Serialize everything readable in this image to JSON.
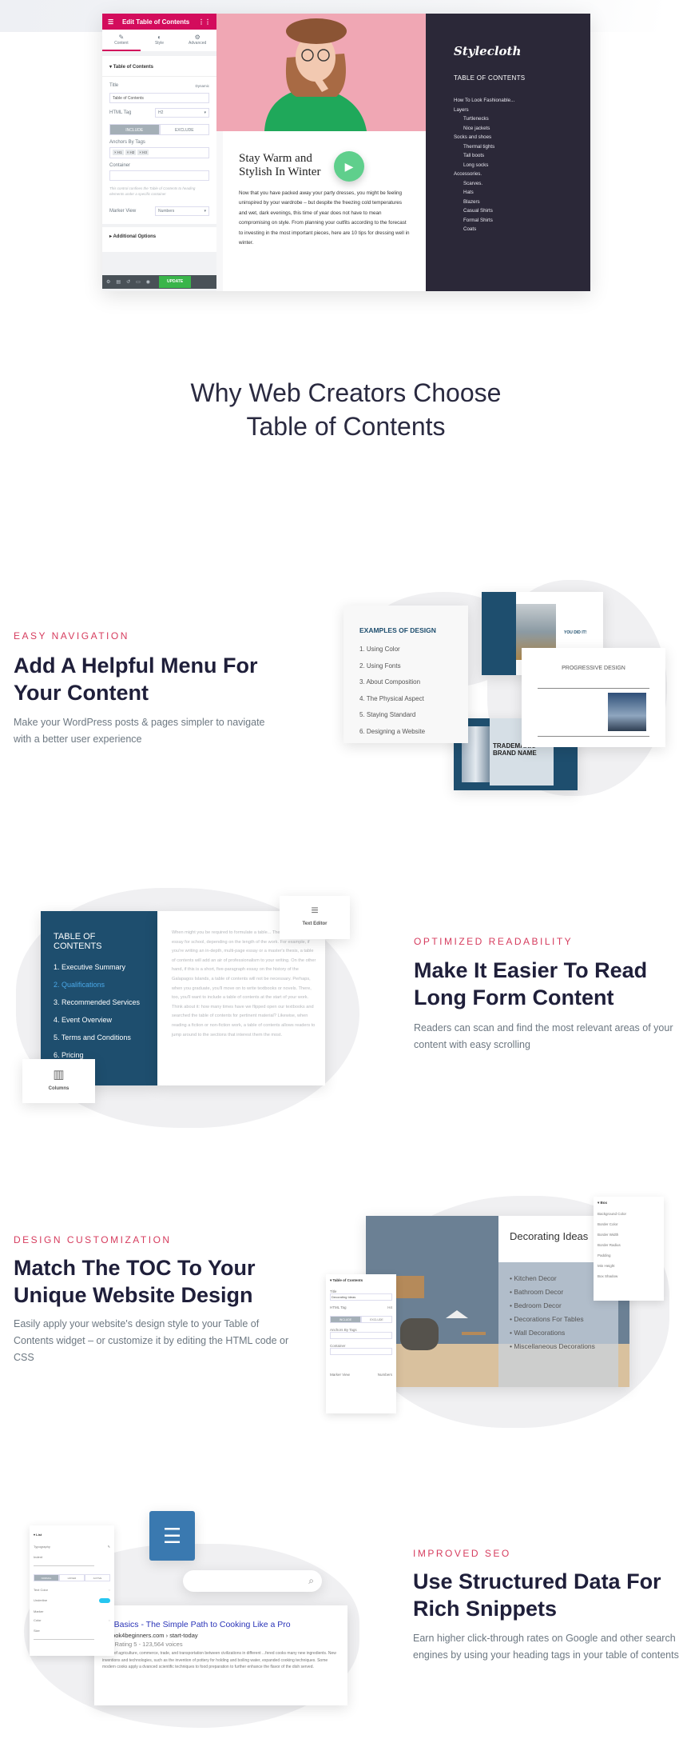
{
  "editor": {
    "header_title": "Edit Table of Contents",
    "tabs": [
      {
        "label": "Content",
        "icon": "pencil-icon"
      },
      {
        "label": "Style",
        "icon": "half-circle-icon"
      },
      {
        "label": "Advanced",
        "icon": "gear-icon"
      }
    ],
    "section": "Table of Contents",
    "title_label": "Title",
    "dynamic_label": "Dynamic",
    "title_value": "Table of Contents",
    "html_tag_label": "HTML Tag",
    "html_tag_value": "H2",
    "include": "INCLUDE",
    "exclude": "EXCLUDE",
    "anchors_label": "Anchors By Tags",
    "tags": [
      "× H1",
      "× H2",
      "× H3"
    ],
    "container_label": "Container",
    "help": "This control confines the Table of Contents to heading elements under a specific container",
    "marker_label": "Marker View",
    "marker_value": "Numbers",
    "additional": "Additional Options",
    "update": "UPDATE"
  },
  "article": {
    "heading": "Stay Warm and Stylish In Winter",
    "body": "Now that you have packed away your party dresses, you might be feeling uninspired by your wardrobe – but despite the freezing cold temperatures and wet, dark evenings, this time of year does not have to mean compromising on style. From planning your outfits according to the forecast to investing in the most important pieces, here are 10 tips for dressing well in winter."
  },
  "stylecloth": {
    "logo": "Stylecloth",
    "toc_title": "TABLE OF CONTENTS",
    "items": [
      {
        "label": "How To Look Fashionable...",
        "sub": false
      },
      {
        "label": "Layers",
        "sub": false
      },
      {
        "label": "Turtlenecks",
        "sub": true
      },
      {
        "label": "Nice jackets",
        "sub": true
      },
      {
        "label": "Socks and shoes",
        "sub": false
      },
      {
        "label": "Thermal tights",
        "sub": true
      },
      {
        "label": "Tall boots",
        "sub": true
      },
      {
        "label": "Long socks",
        "sub": true
      },
      {
        "label": "Accessories.",
        "sub": false
      },
      {
        "label": "Scarves.",
        "sub": true
      },
      {
        "label": "Hats",
        "sub": true
      },
      {
        "label": "Blazers",
        "sub": true
      },
      {
        "label": "Casual Shirts",
        "sub": true
      },
      {
        "label": "Formal Shirts",
        "sub": true
      },
      {
        "label": "Coats",
        "sub": true
      }
    ]
  },
  "why": {
    "line1": "Why Web Creators Choose",
    "line2": "Table of Contents"
  },
  "features": [
    {
      "label": "EASY NAVIGATION",
      "title1": "Add A Helpful Menu For",
      "title2": "Your Content",
      "desc": "Make your WordPress posts & pages simpler to navigate with a better user experience"
    },
    {
      "label": "OPTIMIZED READABILITY",
      "title1": "Make It Easier To Read",
      "title2": "Long Form Content",
      "desc": "Readers can scan and find the most relevant areas of your content with easy scrolling"
    },
    {
      "label": "DESIGN CUSTOMIZATION",
      "title1": "Match The TOC To Your",
      "title2": "Unique Website Design",
      "desc": "Easily apply your website's design style to your Table of Contents widget – or customize it by editing the HTML code or CSS"
    },
    {
      "label": "IMPROVED SEO",
      "title1": "Use Structured Data For",
      "title2": "Rich Snippets",
      "desc": "Earn higher click-through rates on Google and other search engines by using your heading tags in your table of contents"
    }
  ],
  "examples": {
    "title": "EXAMPLES OF DESIGN",
    "items": [
      "1. Using Color",
      "2. Using Fonts",
      "3. About Composition",
      "4. The Physical Aspect",
      "5. Staying Standard",
      "6. Designing a Website"
    ],
    "you_did_it": "YOU DID IT!",
    "progressive": "PROGRESSIVE DESIGN",
    "trademark": "TRADEMARK/ BRAND NAME"
  },
  "readability": {
    "toc_title": "TABLE OF CONTENTS",
    "items": [
      "1. Executive Summary",
      "2. Qualifications",
      "3. Recommended Services",
      "4. Event Overview",
      "5. Terms and Conditions",
      "6. Pricing"
    ],
    "active_index": 1,
    "body": "When might you be required to formulate a table... The first is a formal essay for school, depending on the length of the work. For example, if you're writing an in-depth, multi-page essay or a master's thesis, a table of contents will add an air of professionalism to your writing. On the other hand, if this is a short, five-paragraph essay on the history of the Galapagos Islands, a table of contents will not be necessary. Perhaps, when you graduate, you'll move on to write textbooks or novels. There, too, you'll want to include a table of contents at the start of your work. Think about it: how many times have we flipped open our textbooks and searched the table of contents for pertinent material? Likewise, when reading a fiction or non-fiction work, a table of contents allows readers to jump around to the sections that interest them the most.",
    "text_editor": "Text Editor",
    "columns": "Columns"
  },
  "decor": {
    "title": "Decorating Ideas",
    "items": [
      "Kitchen Decor",
      "Bathroom Decor",
      "Bedroom Decor",
      "Decorations For Tables",
      "Wall Decorations",
      "Miscellaneous Decorations"
    ],
    "box_panel": {
      "title": "Box",
      "rows": [
        "Background Color",
        "Border Color",
        "Border Width",
        "Border Radius",
        "Padding",
        "Min Height",
        "Box Shadow"
      ],
      "border_color": "#1a2fb0"
    },
    "left_panel": {
      "section": "Table of Contents",
      "title_label": "Title",
      "title_value": "Decorating Ideas",
      "tag_label": "HTML Tag",
      "tag_value": "H4",
      "include": "INCLUDE",
      "exclude": "EXCLUDE",
      "anchors": "Anchors By Tags",
      "container": "Container",
      "marker": "Marker View",
      "marker_value": "Numbers"
    }
  },
  "seo": {
    "list_panel": {
      "title": "List",
      "typography": "Typography",
      "indent": "Indent",
      "states": [
        "NORMAL",
        "HOVER",
        "ACTIVE"
      ],
      "text_color": "Text Color",
      "underline": "Underline",
      "marker": "Marker",
      "color": "Color",
      "size": "Size"
    },
    "snippet_title": "en Basics - The Simple Path to Cooking Like a Pro",
    "snippet_url": "okbook4beginners.com › start-today",
    "rating": "Rating 5 - 123,564 voices",
    "stars": 5,
    "snippet_body": "...sion of agriculture, commerce, trade, and transportation between civilizations in different ...fered cooks many new ingredients. New inventions and technologies, such as the invention of pottery for holding and boiling water, expanded cooking techniques. Some modern cooks apply a dvanced scientific techniques to food preparation to further enhance the flavor of the dish served."
  },
  "colors": {
    "accent": "#d63c5e",
    "elementor": "#d30c5c",
    "navy": "#1e4e6e",
    "dark": "#2b2838",
    "play": "#5fcf8c"
  }
}
